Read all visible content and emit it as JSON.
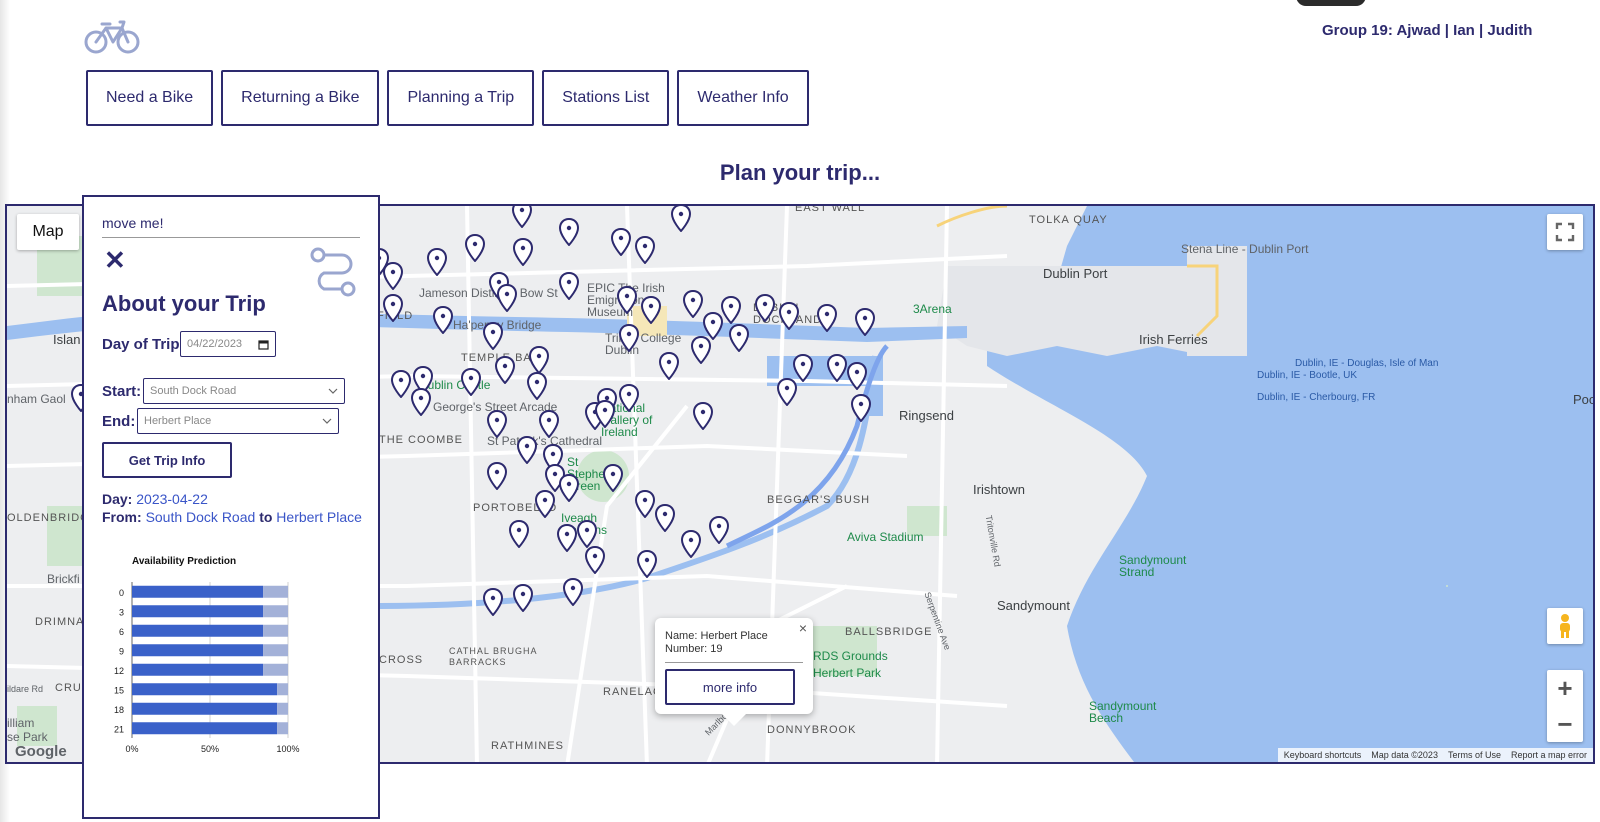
{
  "header": {
    "logo_icon": "bicycle-icon",
    "group_credit": "Group 19: Ajwad | Ian | Judith"
  },
  "nav": {
    "items": [
      "Need a Bike",
      "Returning a Bike",
      "Planning a Trip",
      "Stations List",
      "Weather Info"
    ]
  },
  "page_title": "Plan your trip...",
  "map": {
    "type_button": "Map",
    "fullscreen_icon": "fullscreen-icon",
    "pegman_icon": "pegman-icon",
    "zoom_in": "+",
    "zoom_out": "−",
    "google_logo": "Google",
    "attribution": [
      "Keyboard shortcuts",
      "Map data ©2023",
      "Terms of Use",
      "Report a map error"
    ],
    "labels": {
      "east_wall": "EAST WALL",
      "tolka_quay": "TOLKA QUAY",
      "stena": "Stena Line - Dublin Port",
      "dublin_port": "Dublin Port",
      "three_arena": "3Arena",
      "irish_ferries": "Irish Ferries",
      "ferry1": "Dublin, IE - Douglas, Isle of Man",
      "ferry2": "Dublin, IE - Bootle, UK",
      "ferry3": "Dublin, IE - Cherbourg, FR",
      "ringsend": "Ringsend",
      "irishtown": "Irishtown",
      "sandymount": "Sandymount",
      "sandymount_strand": "Sandymount Strand",
      "sandymount_beach": "Sandymount Beach",
      "aviva": "Aviva Stadium",
      "ballsbridge": "BALLSBRIDGE",
      "rds": "RDS Grounds",
      "herbert_park": "Herbert Park",
      "donnybrook": "DONNYBROOK",
      "ranelagh": "RANELAGH",
      "rathmines": "RATHMINES",
      "portobello": "PORTOBELLO",
      "temple_bar": "TEMPLE BAR",
      "dublin_docklands": "DUBLIN DOCKLANDS",
      "trinity": "Trinity College Dublin",
      "dublin_castle": "Dublin Castle",
      "national_gallery": "National Gallery of Ireland",
      "st_patricks": "St Patrick's Cathedral",
      "jameson": "Jameson Distillery Bow St",
      "hapenny": "Ha'penny Bridge",
      "epic": "EPIC The Irish Emigration Museum",
      "the_coombe": "THE COOMBE",
      "cross": "CROSS",
      "island": "Islan",
      "kilmainham": "nham Gaol",
      "drimnagh": "DRIMNA",
      "crumlin": "CRU",
      "brick": "Brickfi",
      "field": "FIELD",
      "oldenbridge": "OLDENBRIDGE",
      "beggars_bush": "BEGGAR'S BUSH",
      "george_st": "George's Street Arcade",
      "stephens": "St Stephen's Green",
      "iveagh": "Iveagh Gardens",
      "cathal": "CATHAL BRUGHA BARRACKS",
      "poolb": "Poolb",
      "marlborough": "Marlborough Rd",
      "tritonville": "Tritonville Rd",
      "serpentine": "Serpentine Ave",
      "illiam": "illiam",
      "ise_park": "se Park",
      "ildare": "ildare Rd"
    }
  },
  "infowindow": {
    "name_line": "Name: Herbert Place",
    "number_line": "Number: 19",
    "button": "more info",
    "close": "×"
  },
  "panel": {
    "move_me": "move me!",
    "close": "✕",
    "route_icon": "route-icon",
    "title": "About your Trip",
    "day_label": "Day of Trip:",
    "day_value": "04/22/2023",
    "start_label": "Start:",
    "start_value": "South Dock Road",
    "end_label": "End:",
    "end_value": "Herbert Place",
    "button": "Get Trip Info",
    "summary_day_label": "Day:",
    "summary_day": "2023-04-22",
    "summary_from_label": "From:",
    "summary_from": "South Dock Road",
    "summary_to_label": "to",
    "summary_to": "Herbert Place"
  },
  "chart_data": {
    "type": "bar",
    "orientation": "horizontal",
    "stacked": true,
    "title": "Availability Prediction",
    "categories": [
      "0",
      "3",
      "6",
      "9",
      "12",
      "15",
      "18",
      "21"
    ],
    "series": [
      {
        "values": [
          84,
          84,
          84,
          84,
          84,
          93,
          93,
          93
        ],
        "color": "#3a61c9"
      },
      {
        "values": [
          16,
          16,
          16,
          16,
          16,
          7,
          7,
          7
        ],
        "color": "#a3b1d8"
      }
    ],
    "xlim": [
      0,
      100
    ],
    "x_ticks": [
      "0%",
      "50%",
      "100%"
    ],
    "grid": true
  }
}
